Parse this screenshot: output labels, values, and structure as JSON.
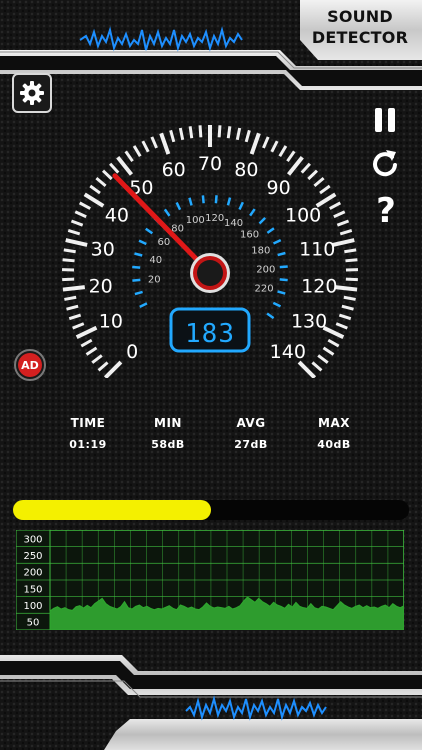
{
  "app": {
    "title_line1": "SOUND",
    "title_line2": "DETECTOR"
  },
  "icons": {
    "settings": "gear-icon",
    "pause": "pause-icon",
    "reset": "refresh-icon",
    "help": "question-mark-icon",
    "ad": "ad-badge-icon"
  },
  "controls": {
    "help_label": "?",
    "ad_label": "AD"
  },
  "gauge": {
    "outer_scale": [
      "0",
      "10",
      "20",
      "30",
      "40",
      "50",
      "60",
      "70",
      "80",
      "90",
      "100",
      "110",
      "120",
      "130",
      "140"
    ],
    "inner_scale": [
      "20",
      "40",
      "60",
      "80",
      "100",
      "120",
      "140",
      "160",
      "180",
      "200",
      "220"
    ],
    "needle_value": 47,
    "digital_readout": "183"
  },
  "stats": {
    "time": {
      "label": "TIME",
      "value": "01:19"
    },
    "min": {
      "label": "MIN",
      "value": "58dB"
    },
    "avg": {
      "label": "AVG",
      "value": "27dB"
    },
    "max": {
      "label": "MAX",
      "value": "40dB"
    }
  },
  "level_bar": {
    "fraction": 0.5
  },
  "chart_data": {
    "type": "area",
    "y_ticks": [
      "300",
      "250",
      "200",
      "150",
      "100",
      "50"
    ],
    "ylim": [
      25,
      325
    ],
    "values": [
      82,
      90,
      95,
      88,
      92,
      86,
      84,
      95,
      98,
      91,
      99,
      92,
      104,
      112,
      120,
      104,
      96,
      92,
      88,
      95,
      110,
      92,
      88,
      96,
      100,
      92,
      96,
      90,
      86,
      90,
      88,
      93,
      98,
      90,
      86,
      100,
      96,
      90,
      94,
      88,
      86,
      94,
      106,
      96,
      91,
      94,
      92,
      90,
      96,
      88,
      92,
      98,
      112,
      124,
      116,
      108,
      120,
      110,
      104,
      96,
      108,
      100,
      96,
      90,
      102,
      94,
      108,
      96,
      92,
      90,
      104,
      92,
      88,
      96,
      94,
      90,
      86,
      98,
      110,
      100,
      94,
      90,
      96,
      100,
      92,
      98,
      92,
      94,
      90,
      96,
      100,
      92,
      104,
      96,
      92,
      98
    ],
    "line_color": "#2ea82e",
    "fill_color": "#2e9c2e",
    "grid_color": "#3fbf3f"
  },
  "colors": {
    "accent_blue": "#22a9ff",
    "needle_red": "#e01818",
    "level_yellow": "#f4f000"
  }
}
